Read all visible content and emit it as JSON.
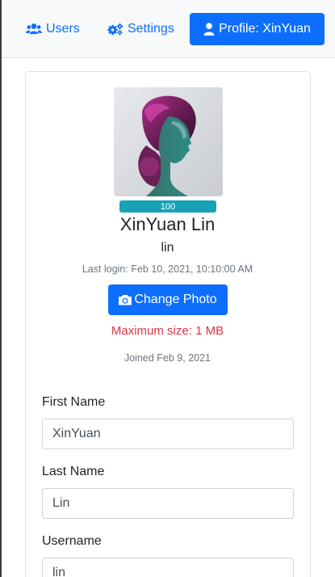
{
  "nav": {
    "users_label": "Users",
    "settings_label": "Settings",
    "profile_label": "Profile: XinYuan",
    "accent_color": "#0d6efd"
  },
  "profile": {
    "full_name": "XinYuan Lin",
    "username": "lin",
    "last_login": "Last login: Feb 10, 2021, 10:10:00 AM",
    "progress_value": "100",
    "progress_percent": 100,
    "change_photo_label": "Change Photo",
    "max_size_note": "Maximum size: 1 MB",
    "joined": "Joined Feb 9, 2021"
  },
  "form": {
    "first_name_label": "First Name",
    "first_name_value": "XinYuan",
    "last_name_label": "Last Name",
    "last_name_value": "Lin",
    "username_label": "Username",
    "username_value": "lin"
  }
}
